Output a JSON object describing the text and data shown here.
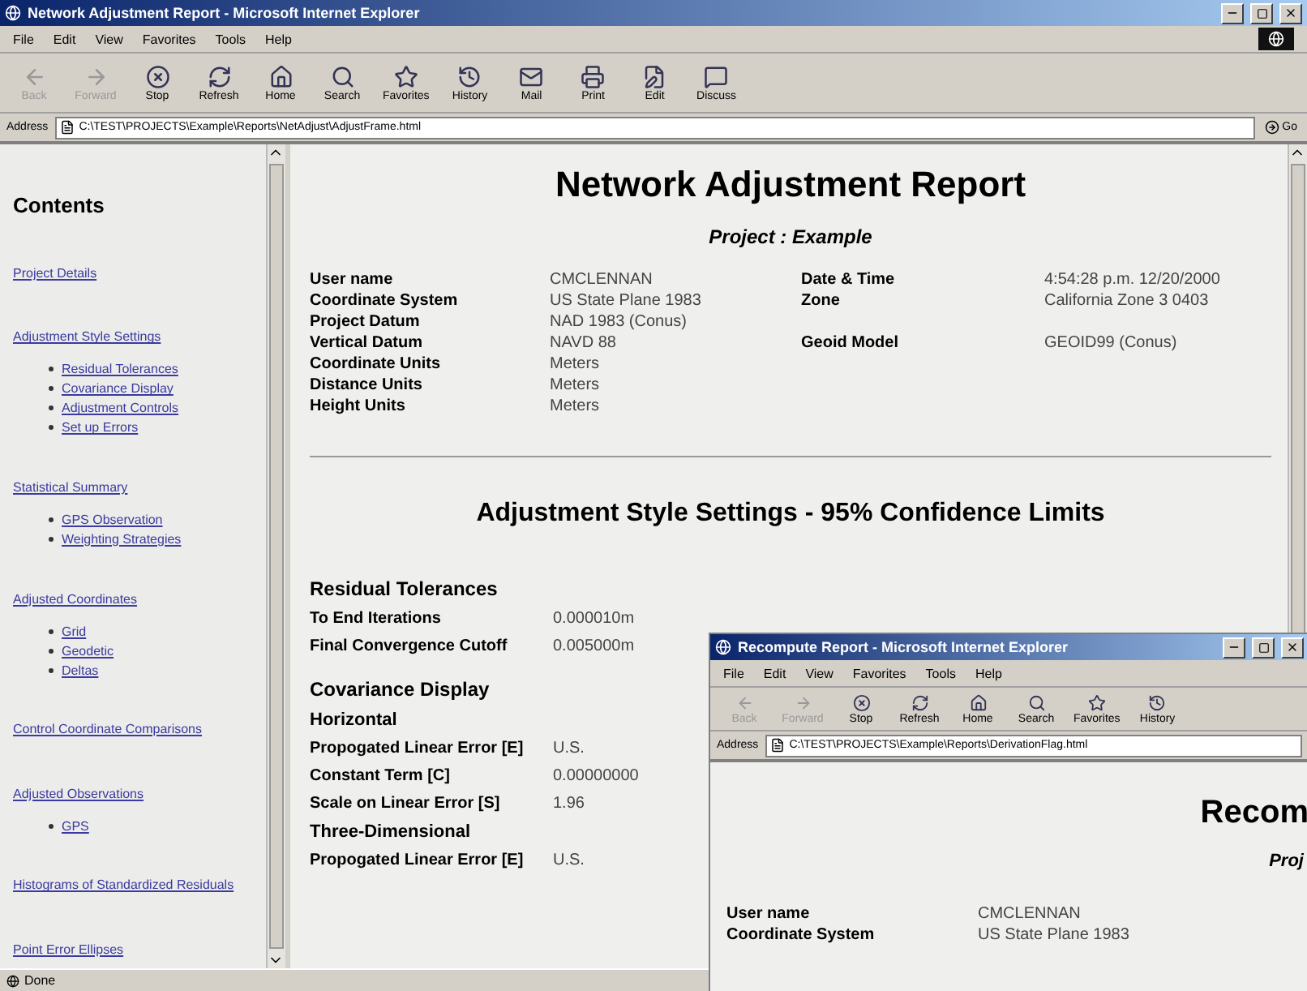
{
  "window": {
    "title": "Network Adjustment Report - Microsoft Internet Explorer"
  },
  "menu": [
    "File",
    "Edit",
    "View",
    "Favorites",
    "Tools",
    "Help"
  ],
  "toolbar": [
    {
      "label": "Back",
      "kind": "back",
      "disabled": true
    },
    {
      "label": "Forward",
      "kind": "forward",
      "disabled": true
    },
    {
      "label": "Stop",
      "kind": "stop",
      "disabled": false
    },
    {
      "label": "Refresh",
      "kind": "refresh",
      "disabled": false
    },
    {
      "label": "Home",
      "kind": "home",
      "disabled": false
    },
    {
      "label": "Search",
      "kind": "search",
      "disabled": false
    },
    {
      "label": "Favorites",
      "kind": "favorites",
      "disabled": false
    },
    {
      "label": "History",
      "kind": "history",
      "disabled": false
    },
    {
      "label": "Mail",
      "kind": "mail",
      "disabled": false
    },
    {
      "label": "Print",
      "kind": "print",
      "disabled": false
    },
    {
      "label": "Edit",
      "kind": "edit",
      "disabled": false
    },
    {
      "label": "Discuss",
      "kind": "discuss",
      "disabled": false
    }
  ],
  "address": {
    "label": "Address",
    "value": "C:\\TEST\\PROJECTS\\Example\\Reports\\NetAdjust\\AdjustFrame.html",
    "go": "Go"
  },
  "contents": {
    "title": "Contents",
    "items": [
      {
        "label": "Project Details"
      },
      {
        "label": "Adjustment Style Settings",
        "children": [
          {
            "label": "Residual Tolerances"
          },
          {
            "label": "Covariance Display"
          },
          {
            "label": "Adjustment Controls"
          },
          {
            "label": "Set up Errors"
          }
        ]
      },
      {
        "label": "Statistical Summary",
        "children": [
          {
            "label": "GPS Observation"
          },
          {
            "label": "Weighting Strategies"
          }
        ]
      },
      {
        "label": "Adjusted Coordinates",
        "children": [
          {
            "label": "Grid"
          },
          {
            "label": "Geodetic"
          },
          {
            "label": "Deltas"
          }
        ]
      },
      {
        "label": "Control Coordinate Comparisons"
      },
      {
        "label": "Adjusted Observations",
        "children": [
          {
            "label": "GPS"
          }
        ]
      },
      {
        "label": "Histograms of Standardized Residuals"
      },
      {
        "label": "Point Error Ellipses"
      }
    ]
  },
  "report": {
    "title": "Network Adjustment Report",
    "project": "Project : Example",
    "details": [
      [
        "User name",
        "CMCLENNAN",
        "Date & Time",
        "4:54:28 p.m. 12/20/2000"
      ],
      [
        "Coordinate System",
        "US State Plane 1983",
        "Zone",
        "California Zone 3 0403"
      ],
      [
        "Project Datum",
        "NAD 1983 (Conus)"
      ],
      [
        "Vertical Datum",
        "NAVD 88",
        "Geoid Model",
        "GEOID99 (Conus)"
      ],
      [
        "Coordinate Units",
        "Meters"
      ],
      [
        "Distance Units",
        "Meters"
      ],
      [
        "Height Units",
        "Meters"
      ]
    ],
    "section": "Adjustment Style Settings - 95% Confidence Limits",
    "settings": [
      {
        "kind": "heading",
        "label": "Residual Tolerances"
      },
      {
        "kind": "row",
        "label": "To End Iterations",
        "value": "0.000010m"
      },
      {
        "kind": "row",
        "label": "Final Convergence Cutoff",
        "value": "0.005000m"
      },
      {
        "kind": "heading",
        "label": "Covariance Display"
      },
      {
        "kind": "subheading",
        "label": "Horizontal"
      },
      {
        "kind": "row",
        "label": "Propogated Linear Error [E]",
        "value": "U.S."
      },
      {
        "kind": "row",
        "label": "Constant Term [C]",
        "value": "0.00000000"
      },
      {
        "kind": "row",
        "label": "Scale on Linear Error [S]",
        "value": "1.96"
      },
      {
        "kind": "subheading",
        "label": "Three-Dimensional"
      },
      {
        "kind": "row",
        "label": "Propogated Linear Error [E]",
        "value": "U.S."
      }
    ]
  },
  "status_bar": "Done",
  "popup": {
    "title": "Recompute Report - Microsoft Internet Explorer",
    "menu": [
      "File",
      "Edit",
      "View",
      "Favorites",
      "Tools",
      "Help"
    ],
    "toolbar": [
      {
        "label": "Back",
        "kind": "back",
        "disabled": true
      },
      {
        "label": "Forward",
        "kind": "forward",
        "disabled": true
      },
      {
        "label": "Stop",
        "kind": "stop",
        "disabled": false
      },
      {
        "label": "Refresh",
        "kind": "refresh",
        "disabled": false
      },
      {
        "label": "Home",
        "kind": "home",
        "disabled": false
      },
      {
        "label": "Search",
        "kind": "search",
        "disabled": false
      },
      {
        "label": "Favorites",
        "kind": "favorites",
        "disabled": false
      },
      {
        "label": "History",
        "kind": "history",
        "disabled": false
      }
    ],
    "address": {
      "label": "Address",
      "value": "C:\\TEST\\PROJECTS\\Example\\Reports\\DerivationFlag.html"
    },
    "heading": "Recom",
    "project": "Proj",
    "details": [
      [
        "User name",
        "CMCLENNAN"
      ],
      [
        "Coordinate System",
        "US State Plane 1983"
      ]
    ]
  }
}
